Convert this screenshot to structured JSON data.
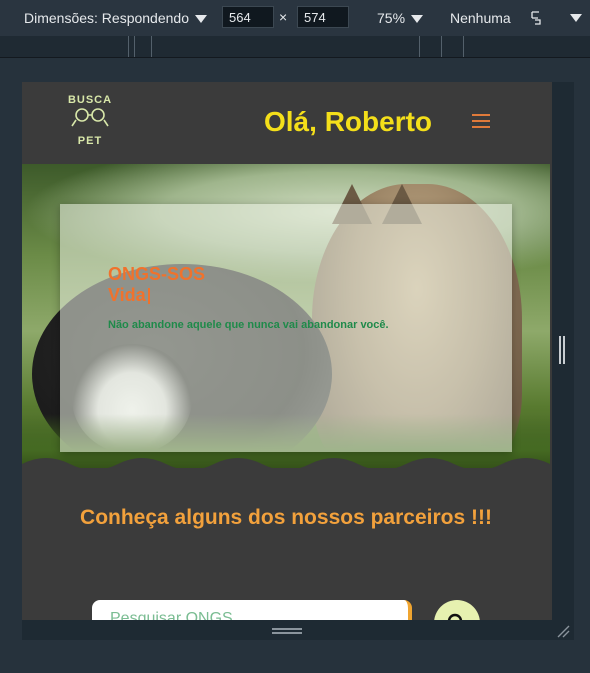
{
  "devtools": {
    "dimensions_label": "Dimensões: Respondendo",
    "width_value": "564",
    "times": "×",
    "height_value": "574",
    "zoom": "75%",
    "throttle": "Nenhuma"
  },
  "header": {
    "logo_top": "BUSCA",
    "logo_bottom": "PET",
    "greeting": "Olá, Roberto"
  },
  "hero": {
    "title_line1": "ONGS-SOS",
    "title_line2": "Vida",
    "text": "Não abandone aquele que nunca vai abandonar você."
  },
  "partners": {
    "title": "Conheça alguns dos nossos parceiros !!!",
    "search_placeholder": "Pesquisar ONGS"
  },
  "colors": {
    "accent_yellow": "#f4df1a",
    "accent_orange": "#f0722c",
    "section_orange": "#f2a13c",
    "green_text": "#1f8a4a"
  }
}
